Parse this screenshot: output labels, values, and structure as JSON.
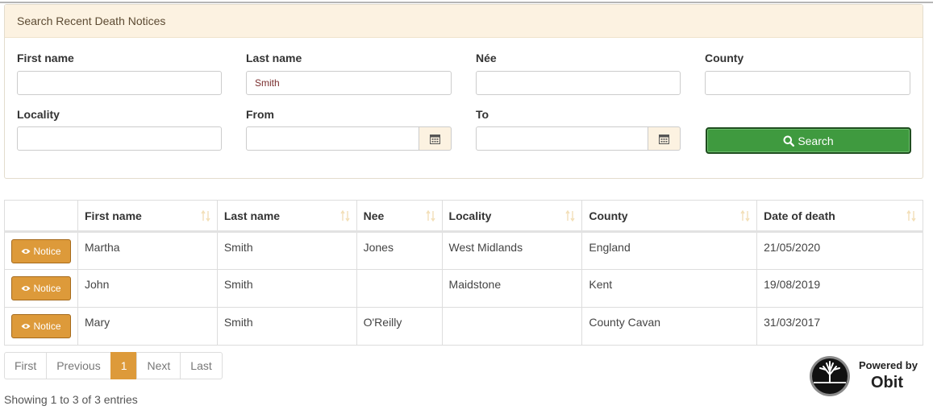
{
  "panel": {
    "heading": "Search Recent Death Notices"
  },
  "form": {
    "first_name": {
      "label": "First name",
      "value": ""
    },
    "last_name": {
      "label": "Last name",
      "value": "Smith"
    },
    "nee": {
      "label": "Née",
      "value": ""
    },
    "county": {
      "label": "County",
      "value": ""
    },
    "locality": {
      "label": "Locality",
      "value": ""
    },
    "from": {
      "label": "From",
      "value": ""
    },
    "to": {
      "label": "To",
      "value": ""
    },
    "search_button": {
      "label": "Search",
      "icon": "search-icon"
    },
    "calendar_icon": "calendar-icon"
  },
  "table": {
    "columns": [
      "First name",
      "Last name",
      "Nee",
      "Locality",
      "County",
      "Date of death"
    ],
    "action_label": "Notice",
    "action_icon": "eye-icon",
    "rows": [
      {
        "first_name": "Martha",
        "last_name": "Smith",
        "nee": "Jones",
        "locality": "West Midlands",
        "county": "England",
        "date_of_death": "21/05/2020"
      },
      {
        "first_name": "John",
        "last_name": "Smith",
        "nee": "",
        "locality": "Maidstone",
        "county": "Kent",
        "date_of_death": "19/08/2019"
      },
      {
        "first_name": "Mary",
        "last_name": "Smith",
        "nee": "O'Reilly",
        "locality": "",
        "county": "County Cavan",
        "date_of_death": "31/03/2017"
      }
    ]
  },
  "pagination": {
    "first": "First",
    "previous": "Previous",
    "current": "1",
    "next": "Next",
    "last": "Last"
  },
  "info": "Showing 1 to 3 of 3 entries",
  "logo": {
    "powered_by": "Powered by",
    "brand": "Obit"
  },
  "colors": {
    "notice_button": "#dd9a3a",
    "search_button": "#3f9a3f",
    "panel_heading": "#fcf2e1"
  }
}
